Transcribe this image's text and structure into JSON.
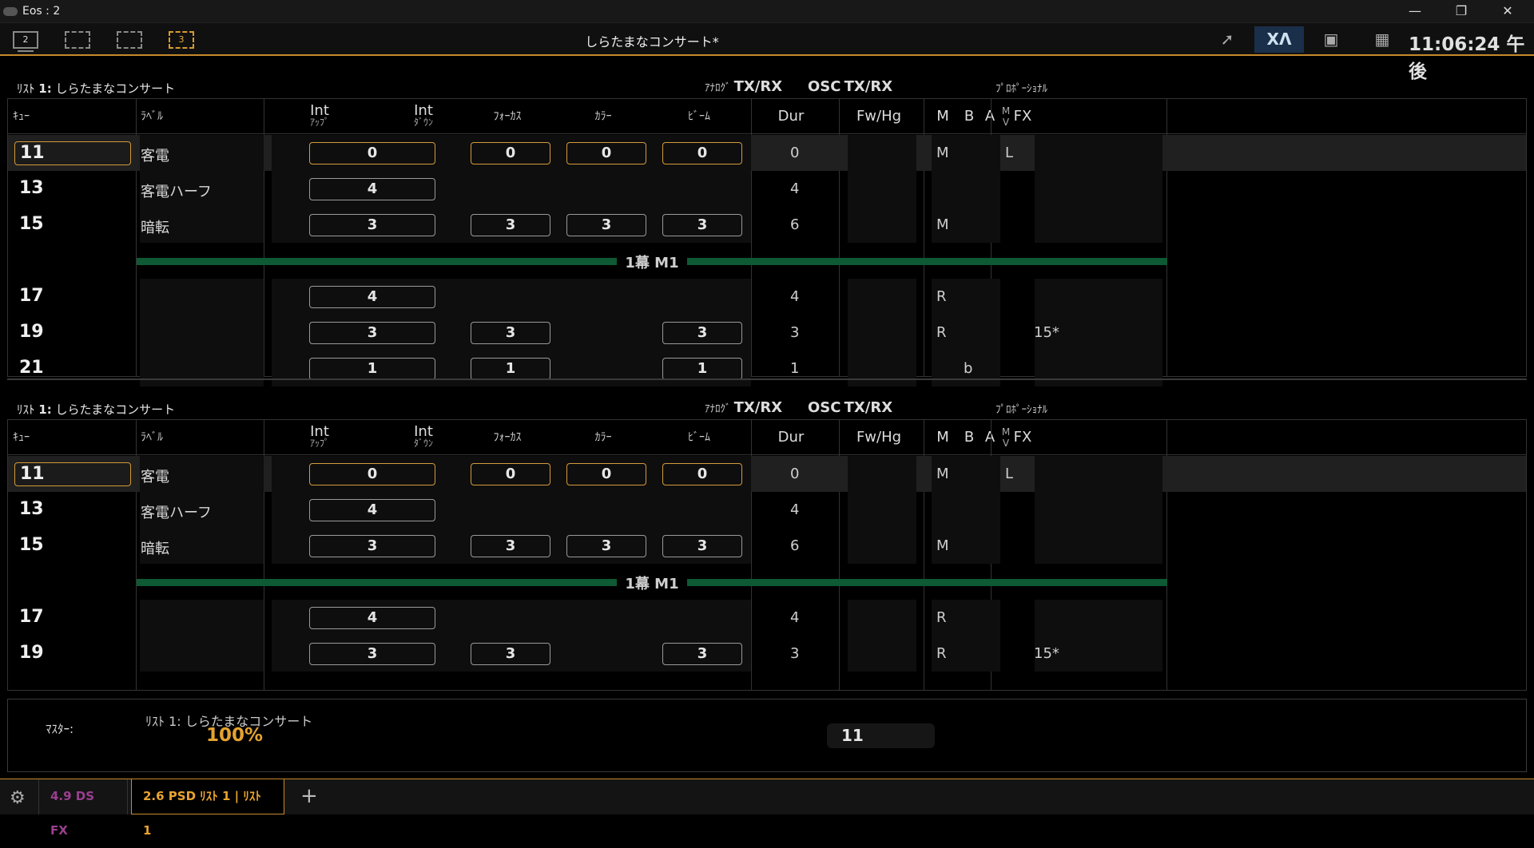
{
  "window": {
    "title": "Eos : 2"
  },
  "toolbar": {
    "display1": "2",
    "display4": "3",
    "doc_title": "しらたまなコンサート*",
    "clock": "11:06:24 午後"
  },
  "list": {
    "title_prefix": "ﾘｽﾄ",
    "title_num": "1:",
    "title_name": "しらたまなコンサート",
    "analog": "ｱﾅﾛｸﾞ",
    "txrx1": "TX/RX",
    "osc": "OSC",
    "txrx2": "TX/RX",
    "proportional": "ﾌﾟﾛﾎﾟｰｼｮﾅﾙ",
    "headers": {
      "cue": "ｷｭｰ",
      "label": "ﾗﾍﾞﾙ",
      "int": "Int",
      "up": "ｱｯﾌﾟ",
      "down": "ﾀﾞｳﾝ",
      "focus": "ﾌｫｰｶｽ",
      "color": "ｶﾗｰ",
      "beam": "ﾋﾞｰﾑ",
      "dur": "Dur",
      "fwhg": "Fw/Hg",
      "m": "M",
      "b": "B",
      "a": "A",
      "mv_m": "M",
      "mv_v": "V",
      "fx": "FX"
    },
    "divider": "1幕 M1"
  },
  "cues": [
    {
      "num": "11",
      "label": "客電",
      "int": "0",
      "focus": "0",
      "color": "0",
      "beam": "0",
      "dur": "0",
      "m": "M",
      "a": "L",
      "fx": ""
    },
    {
      "num": "13",
      "label": "客電ハーフ",
      "int": "4",
      "focus": "",
      "color": "",
      "beam": "",
      "dur": "4",
      "m": "",
      "a": "",
      "fx": ""
    },
    {
      "num": "15",
      "label": "暗転",
      "int": "3",
      "focus": "3",
      "color": "3",
      "beam": "3",
      "dur": "6",
      "m": "M",
      "a": "",
      "fx": ""
    },
    {
      "num": "17",
      "label": "",
      "int": "4",
      "focus": "",
      "color": "",
      "beam": "",
      "dur": "4",
      "m": "R",
      "a": "",
      "fx": ""
    },
    {
      "num": "19",
      "label": "",
      "int": "3",
      "focus": "3",
      "color": "",
      "beam": "3",
      "dur": "3",
      "m": "R",
      "a": "",
      "fx": "15*"
    },
    {
      "num": "21",
      "label": "",
      "int": "1",
      "focus": "1",
      "color": "",
      "beam": "1",
      "dur": "1",
      "m": "",
      "b": "b",
      "a": "",
      "fx": ""
    }
  ],
  "master": {
    "label": "ﾏｽﾀｰ:",
    "name": "ﾘｽﾄ 1: しらたまなコンサート",
    "percent": "100%",
    "cue": "11"
  },
  "tabs": [
    {
      "label": "4.9 DS  FX"
    },
    {
      "label": "2.6 PSD ﾘｽﾄ 1 | ﾘｽﾄ 1"
    },
    {
      "label": "+"
    }
  ],
  "colors": {
    "accent": "#c7892b",
    "selected": "#d49b3d",
    "divider": "#0d5a34",
    "tab_fx": "#9a3f8f"
  }
}
